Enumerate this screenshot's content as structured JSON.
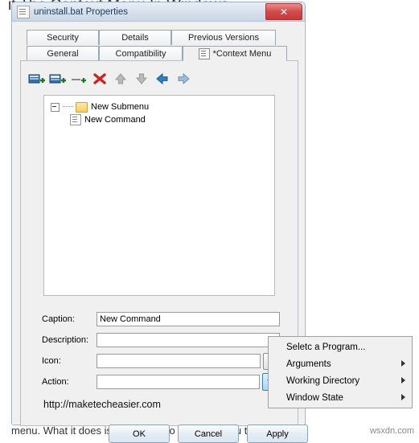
{
  "background": {
    "headline": "it The Context Menu In Windows",
    "bottom_line": "menu. What it does is allows you to add submenu to th",
    "watermark": "wsxdn.com"
  },
  "window": {
    "title": "uninstall.bat Properties",
    "title_icon": "file-icon",
    "close_label": "✕"
  },
  "tabs": {
    "row1": [
      {
        "label": "Security",
        "icon": ""
      },
      {
        "label": "Details",
        "icon": ""
      },
      {
        "label": "Previous Versions",
        "icon": ""
      }
    ],
    "row2": [
      {
        "label": "General",
        "icon": ""
      },
      {
        "label": "Compatibility",
        "icon": ""
      },
      {
        "label": "*Context Menu",
        "icon": "context-menu-icon",
        "selected": true
      }
    ]
  },
  "toolbar": [
    {
      "name": "new-submenu-button",
      "icon": "add-submenu-icon"
    },
    {
      "name": "new-command-button",
      "icon": "add-command-icon"
    },
    {
      "name": "new-separator-button",
      "icon": "add-separator-icon"
    },
    {
      "name": "delete-button",
      "icon": "delete-x-icon"
    },
    {
      "name": "move-up-button",
      "icon": "arrow-up-icon"
    },
    {
      "name": "move-down-button",
      "icon": "arrow-down-icon"
    },
    {
      "name": "move-left-button",
      "icon": "arrow-left-icon"
    },
    {
      "name": "move-right-button",
      "icon": "arrow-right-icon"
    }
  ],
  "tree": {
    "root": {
      "label": "New Submenu",
      "icon": "folder-icon"
    },
    "child": {
      "label": "New Command",
      "icon": "command-icon"
    }
  },
  "form": {
    "caption": {
      "label": "Caption:",
      "value": "New Command",
      "placeholder": ""
    },
    "description": {
      "label": "Description:",
      "value": "",
      "placeholder": ""
    },
    "icon": {
      "label": "Icon:",
      "value": "",
      "placeholder": "",
      "browse_label": "..."
    },
    "action": {
      "label": "Action:",
      "value": "",
      "placeholder": ""
    }
  },
  "url": "http://maketecheasier.com",
  "buttons": {
    "ok": "OK",
    "cancel": "Cancel",
    "apply": "Apply"
  },
  "context_menu": {
    "items": [
      {
        "label": "Seletc a Program...",
        "submenu": false
      },
      {
        "label": "Arguments",
        "submenu": true
      },
      {
        "label": "Working Directory",
        "submenu": true
      },
      {
        "label": "Window State",
        "submenu": true
      }
    ]
  },
  "colors": {
    "accent": "#3c7fb1",
    "close_red": "#d34b4b",
    "folder_yellow": "#f6cf63",
    "title_text": "#1b3a5c"
  }
}
